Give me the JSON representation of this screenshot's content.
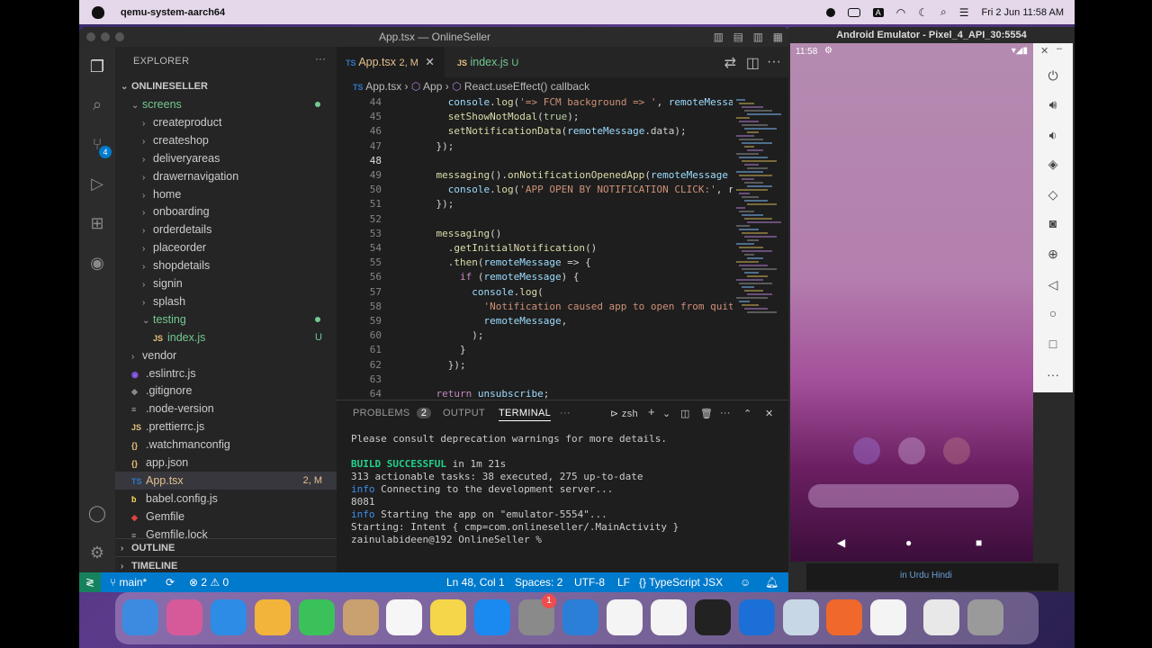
{
  "menubar": {
    "app_name": "qemu-system-aarch64",
    "clock": "Fri 2 Jun  11:58 AM"
  },
  "vscode": {
    "window_title": "App.tsx — OnlineSeller",
    "explorer_label": "EXPLORER",
    "project_name": "ONLINESELLER",
    "tree": [
      {
        "label": "screens",
        "type": "folder-open",
        "indent": 1,
        "modified": true
      },
      {
        "label": "createproduct",
        "type": "folder",
        "indent": 2
      },
      {
        "label": "createshop",
        "type": "folder",
        "indent": 2
      },
      {
        "label": "deliveryareas",
        "type": "folder",
        "indent": 2
      },
      {
        "label": "drawernavigation",
        "type": "folder",
        "indent": 2
      },
      {
        "label": "home",
        "type": "folder",
        "indent": 2
      },
      {
        "label": "onboarding",
        "type": "folder",
        "indent": 2
      },
      {
        "label": "orderdetails",
        "type": "folder",
        "indent": 2
      },
      {
        "label": "placeorder",
        "type": "folder",
        "indent": 2
      },
      {
        "label": "shopdetails",
        "type": "folder",
        "indent": 2
      },
      {
        "label": "signin",
        "type": "folder",
        "indent": 2
      },
      {
        "label": "splash",
        "type": "folder",
        "indent": 2
      },
      {
        "label": "testing",
        "type": "folder-open",
        "indent": 2,
        "modified": true
      },
      {
        "label": "index.js",
        "type": "js",
        "indent": 3,
        "badge": "U"
      },
      {
        "label": "vendor",
        "type": "folder",
        "indent": 1
      },
      {
        "label": ".eslintrc.js",
        "type": "eslint",
        "indent": 1
      },
      {
        "label": ".gitignore",
        "type": "git",
        "indent": 1
      },
      {
        "label": ".node-version",
        "type": "txt",
        "indent": 1
      },
      {
        "label": ".prettierrc.js",
        "type": "js",
        "indent": 1
      },
      {
        "label": ".watchmanconfig",
        "type": "json",
        "indent": 1
      },
      {
        "label": "app.json",
        "type": "json",
        "indent": 1
      },
      {
        "label": "App.tsx",
        "type": "ts",
        "indent": 1,
        "badge": "2, M",
        "active": true
      },
      {
        "label": "babel.config.js",
        "type": "babel",
        "indent": 1
      },
      {
        "label": "Gemfile",
        "type": "ruby",
        "indent": 1
      },
      {
        "label": "Gemfile.lock",
        "type": "txt",
        "indent": 1
      }
    ],
    "outline_label": "OUTLINE",
    "timeline_label": "TIMELINE",
    "tabs": [
      {
        "prefix": "TS",
        "label": "App.tsx",
        "badge": "2, M",
        "active": true
      },
      {
        "prefix": "JS",
        "label": "index.js",
        "badge": "U",
        "active": false
      }
    ],
    "breadcrumb": [
      "App.tsx",
      "App",
      "React.useEffect() callback"
    ],
    "code_lines": [
      {
        "n": "44",
        "text": "      console.log('=> FCM background => ', remoteMessage.d"
      },
      {
        "n": "45",
        "text": "      setShowNotModal(true);"
      },
      {
        "n": "46",
        "text": "      setNotificationData(remoteMessage.data);"
      },
      {
        "n": "47",
        "text": "    });"
      },
      {
        "n": "48",
        "text": ""
      },
      {
        "n": "49",
        "text": "    messaging().onNotificationOpenedApp(remoteMessage => {"
      },
      {
        "n": "50",
        "text": "      console.log('APP OPEN BY NOTIFICATION CLICK:', remot"
      },
      {
        "n": "51",
        "text": "    });"
      },
      {
        "n": "52",
        "text": ""
      },
      {
        "n": "53",
        "text": "    messaging()"
      },
      {
        "n": "54",
        "text": "      .getInitialNotification()"
      },
      {
        "n": "55",
        "text": "      .then(remoteMessage => {"
      },
      {
        "n": "56",
        "text": "        if (remoteMessage) {"
      },
      {
        "n": "57",
        "text": "          console.log("
      },
      {
        "n": "58",
        "text": "            'Notification caused app to open from quit sta"
      },
      {
        "n": "59",
        "text": "            remoteMessage,"
      },
      {
        "n": "60",
        "text": "          );"
      },
      {
        "n": "61",
        "text": "        }"
      },
      {
        "n": "62",
        "text": "      });"
      },
      {
        "n": "63",
        "text": ""
      },
      {
        "n": "64",
        "text": "    return unsubscribe;"
      }
    ],
    "panel_tabs": {
      "problems": "PROBLEMS",
      "problems_count": "2",
      "output": "OUTPUT",
      "terminal": "TERMINAL",
      "shell": "zsh"
    },
    "terminal_lines": [
      "Please consult deprecation warnings for more details.",
      "",
      "BUILD SUCCESSFUL in 1m 21s",
      "313 actionable tasks: 38 executed, 275 up-to-date",
      "info Connecting to the development server...",
      "8081",
      "info Starting the app on \"emulator-5554\"...",
      "Starting: Intent { cmp=com.onlineseller/.MainActivity }",
      "zainulabideen@192 OnlineSeller % "
    ],
    "status": {
      "branch": "main*",
      "errors": "2",
      "warnings": "0",
      "position": "Ln 48, Col 1",
      "spaces": "Spaces: 2",
      "encoding": "UTF-8",
      "eol": "LF",
      "language": "TypeScript JSX"
    }
  },
  "emulator": {
    "title": "Android Emulator - Pixel_4_API_30:5554",
    "phone_time": "11:58",
    "under_text": "in Urdu Hindi",
    "tools": [
      "power-icon",
      "volume-up-icon",
      "volume-down-icon",
      "rotate-left-icon",
      "rotate-right-icon",
      "camera-icon",
      "zoom-icon",
      "back-icon",
      "home-icon",
      "overview-icon",
      "more-icon"
    ]
  },
  "dock": {
    "apps": [
      "finder",
      "launchpad",
      "safari",
      "photos",
      "facetime",
      "contacts",
      "reminders",
      "notes",
      "app-store",
      "system-preferences",
      "vscode",
      "slack",
      "chrome",
      "terminal",
      "xcode",
      "preview",
      "pencil",
      "android-studio",
      "documents",
      "trash"
    ],
    "settings_badge": "1"
  },
  "colors": {
    "accent": "#007acc",
    "modified": "#73c991",
    "error": "#f14c4c",
    "active_tab": "#e2c08d"
  }
}
